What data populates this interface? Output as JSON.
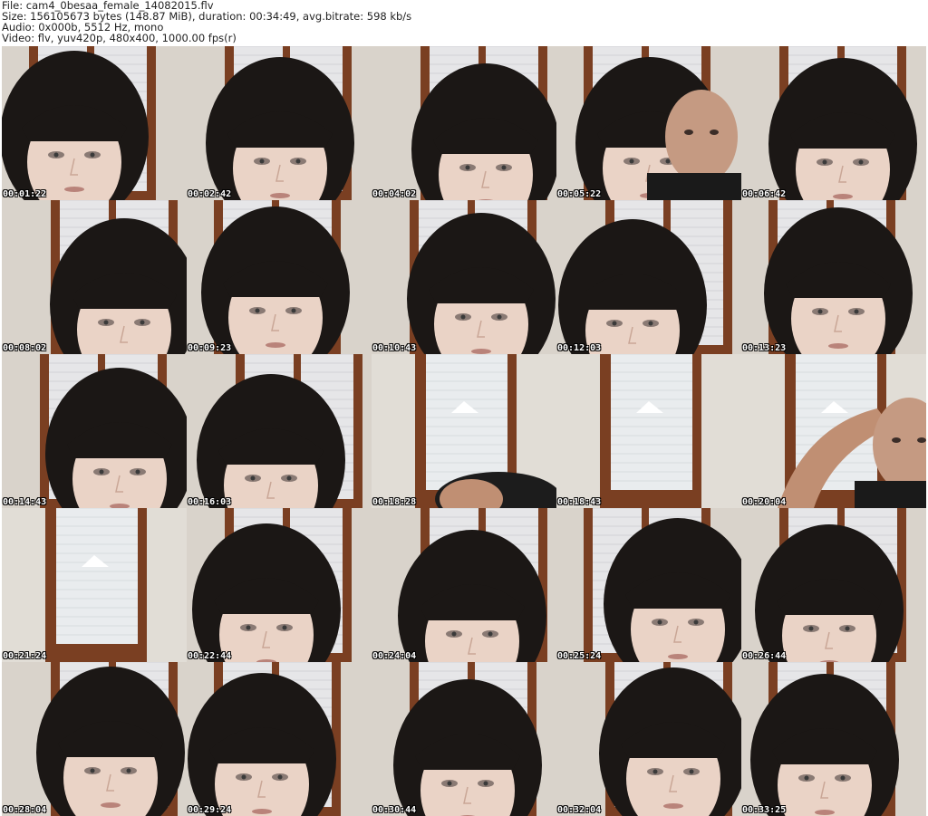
{
  "header": {
    "file": "File: cam4_0besaa_female_14082015.flv",
    "size": "Size: 156105673 bytes (148.87 MiB), duration: 00:34:49, avg.bitrate: 598 kb/s",
    "audio": "Audio: 0x000b, 5512 Hz, mono",
    "video": "Video: flv, yuv420p, 480x400, 1000.00 fps(r)"
  },
  "thumbnails": [
    {
      "time": "00:01:22",
      "scene": "face"
    },
    {
      "time": "00:02:42",
      "scene": "face"
    },
    {
      "time": "00:04:02",
      "scene": "face"
    },
    {
      "time": "00:05:22",
      "scene": "two-faces"
    },
    {
      "time": "00:06:42",
      "scene": "face"
    },
    {
      "time": "00:08:02",
      "scene": "face"
    },
    {
      "time": "00:09:23",
      "scene": "face"
    },
    {
      "time": "00:10:43",
      "scene": "face"
    },
    {
      "time": "00:12:03",
      "scene": "face"
    },
    {
      "time": "00:13:23",
      "scene": "face"
    },
    {
      "time": "00:14:43",
      "scene": "face"
    },
    {
      "time": "00:16:03",
      "scene": "face"
    },
    {
      "time": "00:18:28",
      "scene": "window"
    },
    {
      "time": "00:18:43",
      "scene": "window"
    },
    {
      "time": "00:20:04",
      "scene": "window-man"
    },
    {
      "time": "00:21:24",
      "scene": "window"
    },
    {
      "time": "00:22:44",
      "scene": "face"
    },
    {
      "time": "00:24:04",
      "scene": "face"
    },
    {
      "time": "00:25:24",
      "scene": "face"
    },
    {
      "time": "00:26:44",
      "scene": "face"
    },
    {
      "time": "00:28:04",
      "scene": "face"
    },
    {
      "time": "00:29:24",
      "scene": "face"
    },
    {
      "time": "00:30:44",
      "scene": "face"
    },
    {
      "time": "00:32:04",
      "scene": "face"
    },
    {
      "time": "00:33:25",
      "scene": "face"
    }
  ]
}
